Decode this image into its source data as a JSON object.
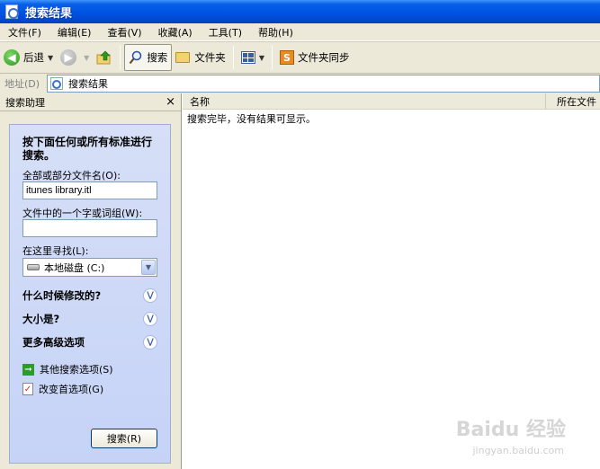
{
  "window": {
    "title": "搜索结果"
  },
  "menu": [
    "文件(F)",
    "编辑(E)",
    "查看(V)",
    "收藏(A)",
    "工具(T)",
    "帮助(H)"
  ],
  "toolbar": {
    "back_label": "后退",
    "search_label": "搜索",
    "folders_label": "文件夹",
    "sync_label": "文件夹同步"
  },
  "address": {
    "label": "地址(D)",
    "value": "搜索结果"
  },
  "assistant": {
    "title": "搜索助理",
    "close": "×",
    "heading": "按下面任何或所有标准进行搜索。",
    "filename_label": "全部或部分文件名(O):",
    "filename_value": "itunes library.itl",
    "phrase_label": "文件中的一个字或词组(W):",
    "phrase_value": "",
    "lookin_label": "在这里寻找(L):",
    "lookin_value": "本地磁盘 (C:)",
    "sections": [
      "什么时候修改的?",
      "大小是?",
      "更多高级选项"
    ],
    "other_options": "其他搜索选项(S)",
    "change_prefs": "改变首选项(G)",
    "search_button": "搜索(R)"
  },
  "results": {
    "columns": [
      "名称",
      "所在文件"
    ],
    "message": "搜索完毕，没有结果可显示。"
  },
  "watermark": {
    "main": "Baidu 经验",
    "sub": "jingyan.baidu.com"
  }
}
